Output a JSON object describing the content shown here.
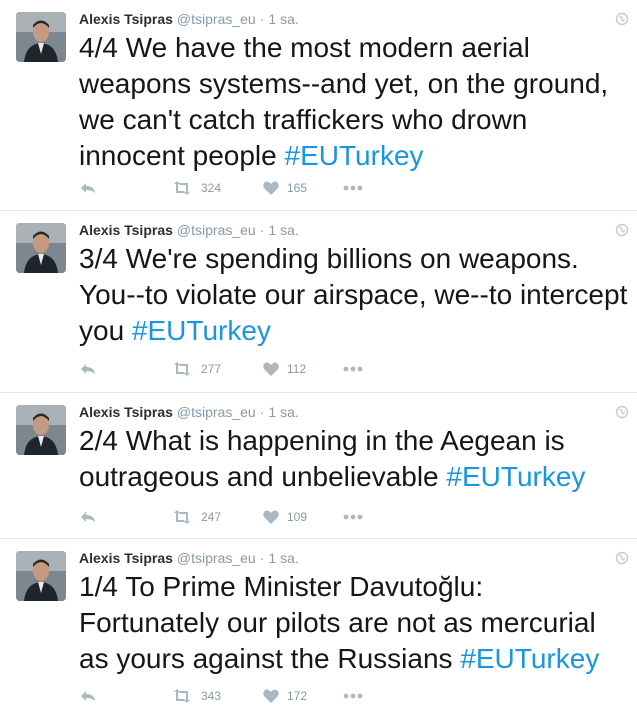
{
  "tweets": [
    {
      "name": "Alexis Tsipras",
      "handle": "@tsipras_eu",
      "separator": "·",
      "time": "1 sa.",
      "text": "4/4 We have the most modern aerial weapons systems--and yet, on the ground, we can't catch traffickers who drown innocent people",
      "hashtag": "#EUTurkey",
      "retweets": "324",
      "likes": "165"
    },
    {
      "name": "Alexis Tsipras",
      "handle": "@tsipras_eu",
      "separator": "·",
      "time": "1 sa.",
      "text": "3/4 We're spending billions on weapons. You--to violate our airspace, we--to intercept you",
      "hashtag": "#EUTurkey",
      "retweets": "277",
      "likes": "112"
    },
    {
      "name": "Alexis Tsipras",
      "handle": "@tsipras_eu",
      "separator": "·",
      "time": "1 sa.",
      "text": "2/4 What is happening in the Aegean is outrageous and unbelievable",
      "hashtag": "#EUTurkey",
      "retweets": "247",
      "likes": "109"
    },
    {
      "name": "Alexis Tsipras",
      "handle": "@tsipras_eu",
      "separator": "·",
      "time": "1 sa.",
      "text": "1/4 To Prime Minister Davutoğlu: Fortunately our pilots are not as mercurial as yours against the Russians",
      "hashtag": "#EUTurkey",
      "retweets": "343",
      "likes": "172"
    }
  ],
  "colors": {
    "hashtag": "#1b95e0",
    "meta": "#8899a6",
    "divider": "#e1e8ed"
  },
  "icons": {
    "reply": "reply-icon",
    "retweet": "retweet-icon",
    "like": "heart-icon",
    "more": "more-icon",
    "globe": "globe-icon"
  }
}
